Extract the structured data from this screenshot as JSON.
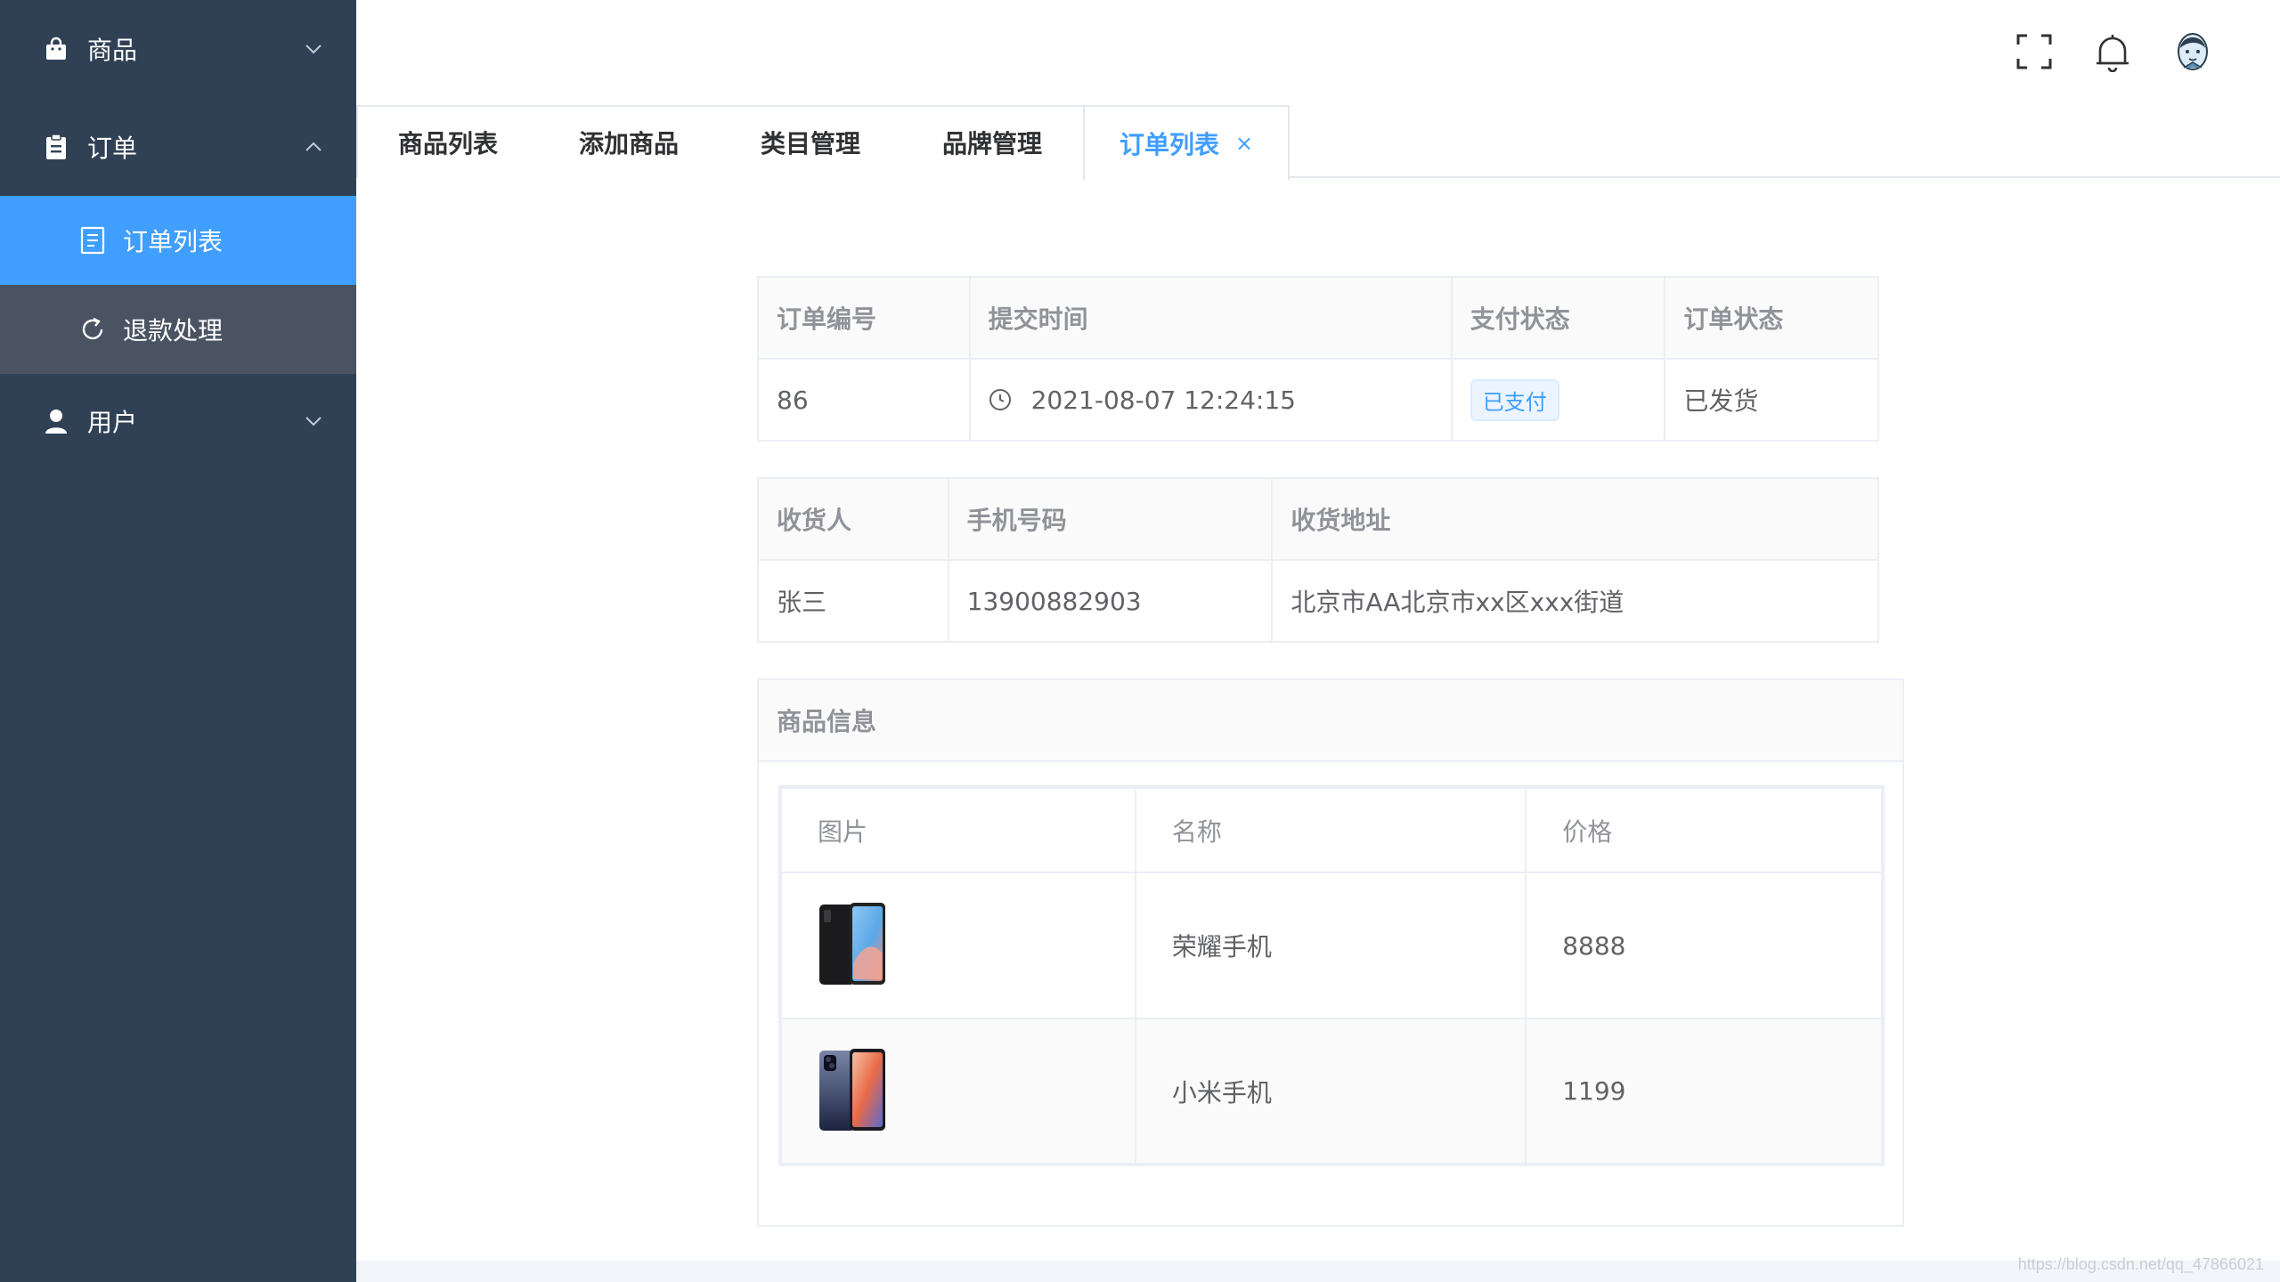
{
  "sidebar": {
    "menus": [
      {
        "label": "商品",
        "icon": "shopping-bag-icon",
        "expanded": false
      },
      {
        "label": "订单",
        "icon": "clipboard-icon",
        "expanded": true
      },
      {
        "label": "用户",
        "icon": "user-icon",
        "expanded": false
      }
    ],
    "order_submenu": [
      {
        "label": "订单列表",
        "icon": "document-icon",
        "active": true
      },
      {
        "label": "退款处理",
        "icon": "refresh-icon",
        "active": false
      }
    ]
  },
  "header": {
    "icons": [
      "fullscreen-icon",
      "bell-icon",
      "avatar"
    ]
  },
  "tabs": [
    {
      "label": "商品列表",
      "active": false
    },
    {
      "label": "添加商品",
      "active": false
    },
    {
      "label": "类目管理",
      "active": false
    },
    {
      "label": "品牌管理",
      "active": false
    },
    {
      "label": "订单列表",
      "active": true,
      "close": "×"
    }
  ],
  "order_info": {
    "headers": [
      "订单编号",
      "提交时间",
      "支付状态",
      "订单状态"
    ],
    "order_id": "86",
    "submit_time": "2021-08-07 12:24:15",
    "pay_status": "已支付",
    "order_status": "已发货"
  },
  "receiver_info": {
    "headers": [
      "收货人",
      "手机号码",
      "收货地址"
    ],
    "name": "张三",
    "phone": "13900882903",
    "address": "北京市AA北京市xx区xxx街道"
  },
  "goods_info": {
    "title": "商品信息",
    "headers": [
      "图片",
      "名称",
      "价格"
    ],
    "rows": [
      {
        "image": "honor-phone-image",
        "name": "荣耀手机",
        "price": "8888"
      },
      {
        "image": "xiaomi-phone-image",
        "name": "小米手机",
        "price": "1199"
      }
    ]
  },
  "colors": {
    "sidebar_bg": "#304156",
    "active_menu": "#409eff",
    "primary": "#409eff"
  },
  "watermark": "https://blog.csdn.net/qq_47866021"
}
